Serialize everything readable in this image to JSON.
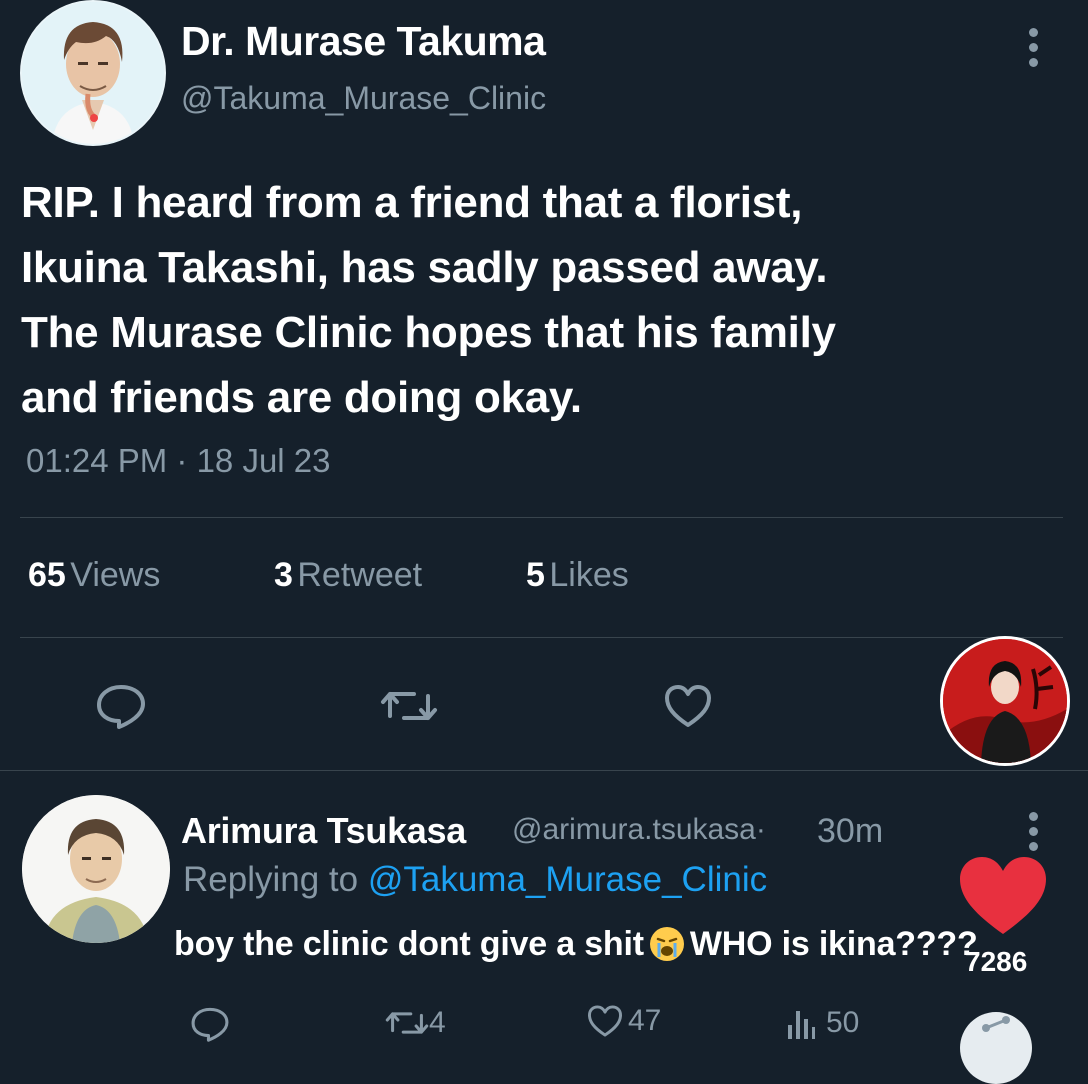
{
  "tweet": {
    "author_name": "Dr. Murase Takuma",
    "author_handle": "@Takuma_Murase_Clinic",
    "text_lines": [
      "RIP. I heard from a friend that a florist,",
      "Ikuina Takashi, has sadly passed away.",
      "The Murase Clinic hopes that his family",
      "and friends are doing okay."
    ],
    "timestamp": "01:24 PM · 18 Jul 23",
    "stats": {
      "views_count": "65",
      "views_label": "Views",
      "retweets_count": "3",
      "retweets_label": "Retweet",
      "likes_count": "5",
      "likes_label": "Likes"
    },
    "actions": [
      "reply-icon",
      "retweet-icon",
      "like-icon"
    ]
  },
  "reply": {
    "author_name": "Arimura Tsukasa",
    "author_handle": "@arimura.tsukasa",
    "separator": "·",
    "time_ago": "30m",
    "replying_prefix": "Replying to",
    "replying_to": "@Takuma_Murase_Clinic",
    "text_before_emoji": "boy the clinic dont give a shit",
    "emoji": "loudly-crying-face",
    "text_after_emoji": "WHO is ikina????",
    "actions": {
      "reply_count": "",
      "retweet_count": "4",
      "like_count": "47",
      "views_count": "50"
    }
  },
  "overlay": {
    "heart_count": "7286",
    "heart_color": "#e8303f"
  },
  "colors": {
    "background": "#15202b",
    "muted_text": "#8899a6",
    "link": "#1da1f2",
    "divider": "#38444d"
  }
}
